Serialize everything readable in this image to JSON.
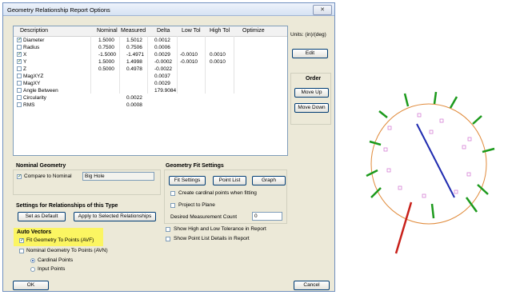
{
  "dialog": {
    "title": "Geometry Relationship Report Options",
    "close_label": "✕"
  },
  "table": {
    "headers": [
      "Description",
      "Nominal",
      "Measured",
      "Delta",
      "Low Tol",
      "High Tol",
      "Optimize"
    ],
    "rows": [
      {
        "checked": true,
        "desc": "Diameter",
        "nominal": "1.5000",
        "measured": "1.5012",
        "delta": "0.0012",
        "low": "",
        "high": ""
      },
      {
        "checked": false,
        "desc": "Radius",
        "nominal": "0.7500",
        "measured": "0.7506",
        "delta": "0.0006",
        "low": "",
        "high": ""
      },
      {
        "checked": true,
        "desc": "X",
        "nominal": "-1.5000",
        "measured": "-1.4971",
        "delta": "0.0029",
        "low": "-0.0010",
        "high": "0.0010"
      },
      {
        "checked": true,
        "desc": "Y",
        "nominal": "1.5000",
        "measured": "1.4998",
        "delta": "-0.0002",
        "low": "-0.0010",
        "high": "0.0010"
      },
      {
        "checked": false,
        "desc": "Z",
        "nominal": "0.5000",
        "measured": "0.4978",
        "delta": "-0.0022",
        "low": "",
        "high": ""
      },
      {
        "checked": false,
        "desc": "MagXYZ",
        "nominal": "",
        "measured": "",
        "delta": "0.0037",
        "low": "",
        "high": ""
      },
      {
        "checked": false,
        "desc": "MagXY",
        "nominal": "",
        "measured": "",
        "delta": "0.0029",
        "low": "",
        "high": ""
      },
      {
        "checked": false,
        "desc": "Angle Between",
        "nominal": "",
        "measured": "",
        "delta": "179.9084",
        "low": "",
        "high": ""
      },
      {
        "checked": false,
        "desc": "Circularity",
        "nominal": "",
        "measured": "0.0022",
        "delta": "",
        "low": "",
        "high": ""
      },
      {
        "checked": false,
        "desc": "RMS",
        "nominal": "",
        "measured": "0.0008",
        "delta": "",
        "low": "",
        "high": ""
      }
    ]
  },
  "units": {
    "label": "Units: (in)/(deg)",
    "edit_label": "Edit"
  },
  "order": {
    "title": "Order",
    "move_up": "Move Up",
    "move_down": "Move Down"
  },
  "nominal_geometry": {
    "title": "Nominal Geometry",
    "compare_label": "Compare to Nominal",
    "compare_checked": true,
    "value": "Big Hole"
  },
  "settings": {
    "title": "Settings for Relationships of this Type",
    "set_default": "Set as Default",
    "apply_selected": "Apply to Selected Relationships"
  },
  "auto_vectors": {
    "title": "Auto Vectors",
    "fit_label": "Fit Geometry To Points (AVF)",
    "fit_checked": true,
    "nominal_label": "Nominal Geometry To Points (AVN)",
    "nominal_checked": false,
    "cardinal_label": "Cardinal Points",
    "input_label": "Input Points",
    "selected": "Cardinal Points"
  },
  "fit_settings": {
    "title": "Geometry Fit Settings",
    "fit_settings_btn": "Fit Settings",
    "point_list_btn": "Point List",
    "graph_btn": "Graph",
    "cardinal_label": "Create cardinal points when fitting",
    "project_label": "Project to Plane",
    "desired_label": "Desired Measurement Count",
    "desired_value": "0",
    "show_tol_label": "Show High and Low Tolerance in Report",
    "show_points_label": "Show Point List Details in Report"
  },
  "footer": {
    "ok": "OK",
    "cancel": "Cancel"
  },
  "colors": {
    "highlight": "#fbf562",
    "circle": "#e08a3a",
    "axis": "#1f2bb0",
    "red_vector": "#c8201a",
    "green_vector": "#1c9a1c",
    "point": "#d070d0"
  }
}
